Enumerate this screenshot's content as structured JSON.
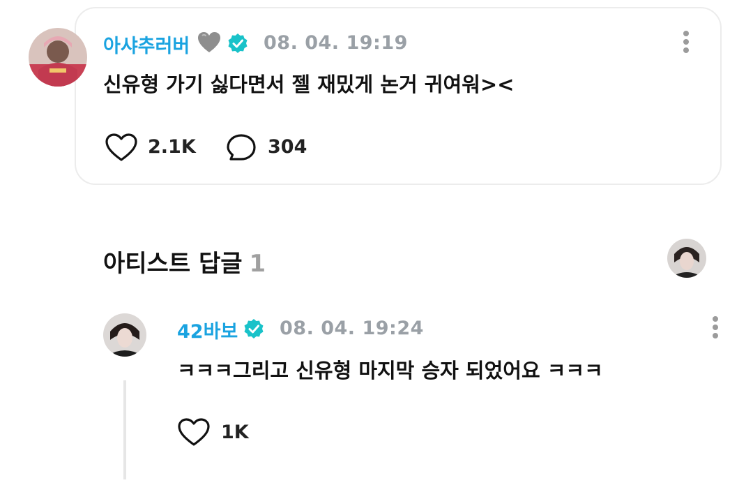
{
  "post": {
    "author": "아샤추러버",
    "author_emoji": "grey-heart-icon",
    "verified_icon": "verified-badge-icon",
    "timestamp": "08. 04. 19:19",
    "text": "신유형 가기 싫다면서 젤 재밌게 논거 귀여워><",
    "like_icon": "heart-outline-icon",
    "likes": "2.1K",
    "comment_icon": "speech-bubble-icon",
    "comments": "304",
    "more_icon": "more-vertical-icon"
  },
  "artist_replies": {
    "title": "아티스트 답글",
    "count": "1"
  },
  "reply": {
    "author": "42바보",
    "verified_icon": "verified-badge-icon",
    "timestamp": "08. 04. 19:24",
    "text": "ㅋㅋㅋ그리고 신유형 마지막 승자 되었어요 ㅋㅋㅋ",
    "like_icon": "heart-outline-icon",
    "likes": "1K",
    "more_icon": "more-vertical-icon"
  },
  "colors": {
    "name_blue": "#1aa3e0",
    "verified_teal": "#19c2c9",
    "timestamp_grey": "#9aa0a6",
    "card_border": "#ececec"
  }
}
